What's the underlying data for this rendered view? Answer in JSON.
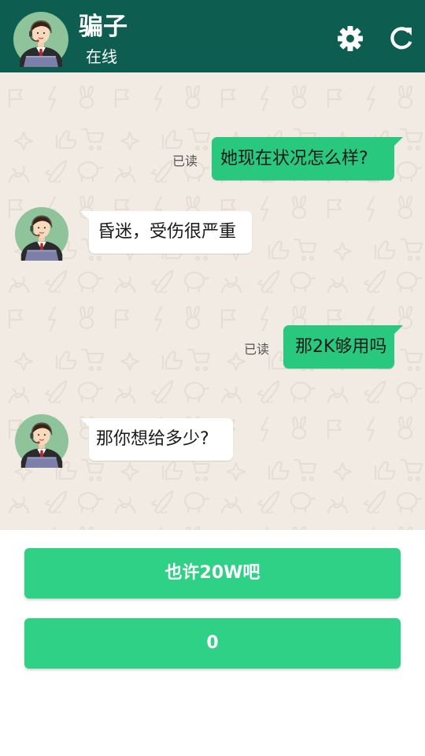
{
  "header": {
    "contact_name": "骗子",
    "status": "在线",
    "avatar_icon": "operator-avatar-icon",
    "settings_icon": "gear-icon",
    "refresh_icon": "refresh-icon",
    "background_color": "#0d5e51"
  },
  "chat": {
    "background_color": "#f1ebe4",
    "messages": [
      {
        "direction": "outgoing",
        "text": "她现在状况怎么样?",
        "read_label": "已读"
      },
      {
        "direction": "incoming",
        "text": "昏迷，受伤很严重"
      },
      {
        "direction": "outgoing",
        "text": "那2K够用吗",
        "read_label": "已读"
      },
      {
        "direction": "incoming",
        "text": "那你想给多少?"
      }
    ]
  },
  "replies": {
    "options": [
      {
        "label": "也许20W吧"
      },
      {
        "label": "0"
      }
    ],
    "button_color": "#2ed185"
  }
}
